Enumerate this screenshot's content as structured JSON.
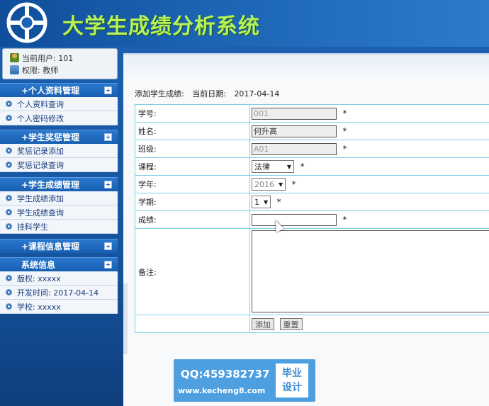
{
  "header": {
    "title": "大学生成绩分析系统"
  },
  "user": {
    "current_user": "当前用户: 101",
    "role": "权限: 教师"
  },
  "menu": [
    {
      "title": "+个人资料管理",
      "items": [
        "个人资料查询",
        "个人密码修改"
      ]
    },
    {
      "title": "+学生奖惩管理",
      "items": [
        "奖惩记录添加",
        "奖惩记录查询"
      ]
    },
    {
      "title": "+学生成绩管理",
      "items": [
        "学生成绩添加",
        "学生成绩查询",
        "挂科学生"
      ]
    },
    {
      "title": "+课程信息管理",
      "items": []
    },
    {
      "title": "系统信息",
      "items": [
        "版权: xxxxx",
        "开发时间: 2017-04-14",
        "学校: xxxxx"
      ]
    }
  ],
  "page": {
    "heading": "添加学生成绩:",
    "date_label": "当前日期:",
    "date_value": "2017-04-14"
  },
  "form": {
    "student_id": {
      "label": "学号:",
      "value": "001"
    },
    "name": {
      "label": "姓名:",
      "value": "何升高"
    },
    "class": {
      "label": "班级:",
      "value": "A01"
    },
    "course": {
      "label": "课程:",
      "value": "法律"
    },
    "year": {
      "label": "学年:",
      "value": "2016"
    },
    "term": {
      "label": "学期:",
      "value": "1"
    },
    "score": {
      "label": "成绩:",
      "value": ""
    },
    "note": {
      "label": "备注:",
      "value": ""
    },
    "required_mark": "*",
    "add_button": "添加",
    "reset_button": "重置"
  },
  "watermark": {
    "qq": "QQ:459382737",
    "site": "www.kecheng8.com",
    "badge_line1": "毕业",
    "badge_line2": "设计"
  }
}
